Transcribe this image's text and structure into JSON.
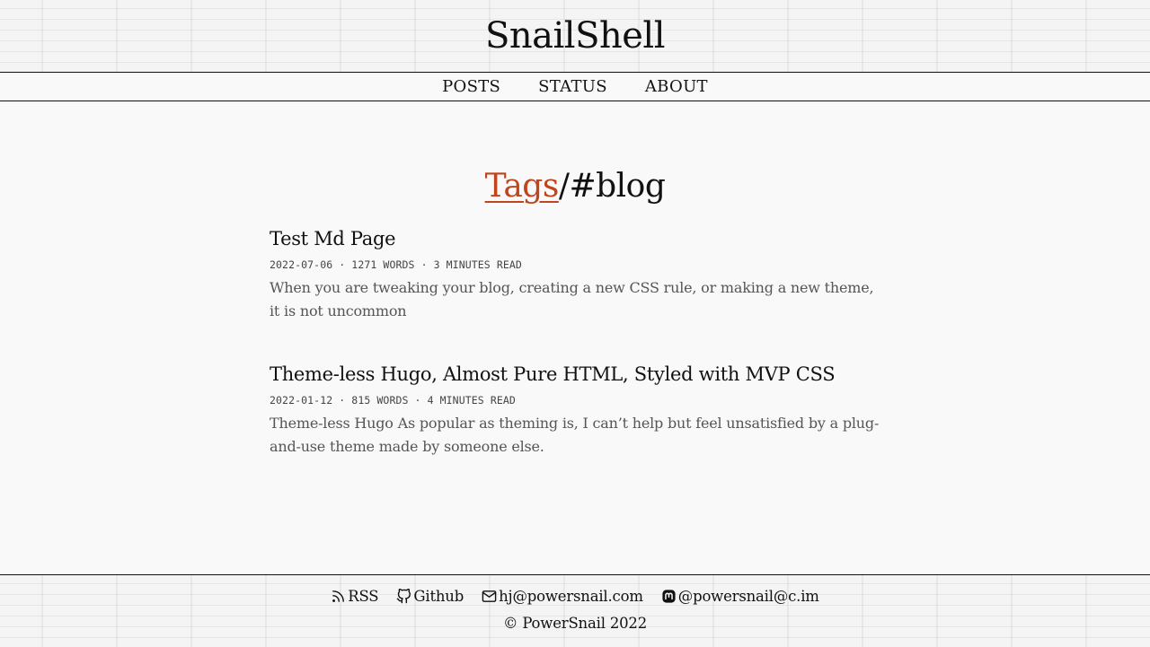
{
  "site": {
    "title": "SnailShell"
  },
  "nav": {
    "items": [
      {
        "label": "POSTS"
      },
      {
        "label": "STATUS"
      },
      {
        "label": "ABOUT"
      }
    ]
  },
  "heading": {
    "link_label": "Tags",
    "suffix": "/#blog",
    "link_color": "#c0451d"
  },
  "posts": [
    {
      "title": "Test Md Page",
      "meta": "2022-07-06 · 1271 WORDS · 3 MINUTES READ",
      "summary": "When you are tweaking your blog, creating a new CSS rule, or making a new theme, it is not uncommon"
    },
    {
      "title": "Theme-less Hugo, Almost Pure HTML, Styled with MVP CSS",
      "meta": "2022-01-12 · 815 WORDS · 4 MINUTES READ",
      "summary": "Theme-less Hugo As popular as theming is, I can’t help but feel unsatisfied by a plug-and-use theme made by someone else."
    }
  ],
  "footer": {
    "links": [
      {
        "label": "RSS",
        "icon": "rss-icon"
      },
      {
        "label": "Github",
        "icon": "github-icon"
      },
      {
        "label": "hj@powersnail.com",
        "icon": "mail-icon"
      },
      {
        "label": "@powersnail@c.im",
        "icon": "mastodon-icon"
      }
    ],
    "copyright": "© PowerSnail 2022"
  }
}
